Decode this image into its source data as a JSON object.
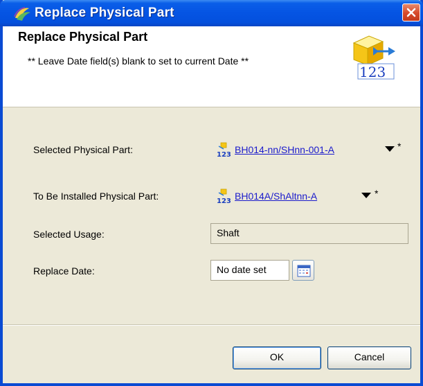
{
  "window": {
    "title": "Replace Physical Part"
  },
  "header": {
    "title": "Replace Physical Part",
    "subtitle": "** Leave Date field(s) blank to set to current Date **",
    "icon": "part-replace-icon"
  },
  "form": {
    "selected_part": {
      "label": "Selected Physical Part:",
      "value": "BH014-nn/SHnn-001-A",
      "required": "*"
    },
    "to_install_part": {
      "label": "To Be Installed Physical Part:",
      "value": "BH014A/ShAltnn-A",
      "required": "*"
    },
    "selected_usage": {
      "label": "Selected Usage:",
      "value": "Shaft"
    },
    "replace_date": {
      "label": "Replace Date:",
      "value": "No date set"
    }
  },
  "buttons": {
    "ok": "OK",
    "cancel": "Cancel"
  },
  "colors": {
    "titlebar": "#0554e3",
    "dialog_background": "#ece9d8",
    "link": "#1a1acc"
  }
}
